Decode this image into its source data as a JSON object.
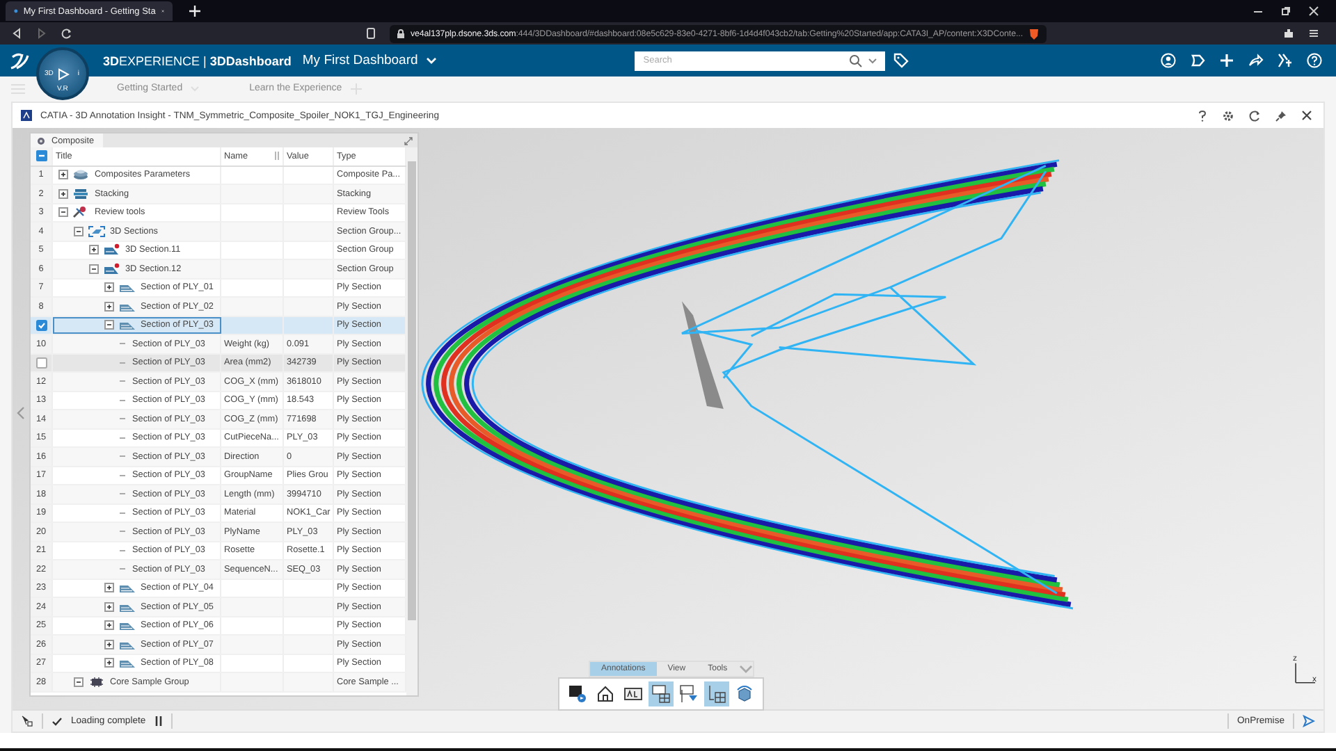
{
  "browser": {
    "tab_title": "My First Dashboard - Getting Sta",
    "url_host": "ve4al137plp.dsone.3ds.com",
    "url_rest": ":444/3DDashboard/#dashboard:08e5c629-83e0-4271-8bf6-1d4d4f043cb2/tab:Getting%20Started/app:CATA3I_AP/content:X3DConte..."
  },
  "header": {
    "brand": "**3D**EXPERIENCE | **3DDashboard**",
    "dashboard": "My First Dashboard",
    "search": {
      "placeholder": "Search"
    },
    "compass_labels": [
      "3D",
      "i",
      "V.R"
    ]
  },
  "dashboard_tabs": [
    "Getting Started",
    "Learn the Experience"
  ],
  "app": {
    "title": "CATIA - 3D Annotation Insight - TNM_Symmetric_Composite_Spoiler_NOK1_TGJ_Engineering"
  },
  "tree": {
    "tab": "Composite",
    "columns": [
      "Title",
      "Name",
      "Value",
      "Type"
    ],
    "rows": [
      {
        "num": "1",
        "kind": "parameters",
        "title": "Composites Parameters",
        "type": "Composite Pa...",
        "expanded": false,
        "selected": false,
        "hovered": false
      },
      {
        "num": "2",
        "kind": "stacking",
        "title": "Stacking",
        "type": "Stacking",
        "expanded": false,
        "selected": false,
        "hovered": false
      },
      {
        "num": "3",
        "kind": "review",
        "title": "Review tools",
        "type": "Review Tools",
        "expanded": true,
        "selected": false,
        "hovered": false,
        "children": [
          {
            "num": "4",
            "kind": "sections",
            "title": "3D Sections",
            "type": "Section Group...",
            "expanded": true,
            "selected": false,
            "hovered": false,
            "children": [
              {
                "num": "5",
                "kind": "group",
                "title": "3D Section.11",
                "type": "Section Group",
                "expanded": false,
                "selected": false,
                "hovered": false
              },
              {
                "num": "6",
                "kind": "group",
                "title": "3D Section.12",
                "type": "Section Group",
                "expanded": true,
                "selected": false,
                "hovered": false,
                "children": [
                  {
                    "num": "7",
                    "kind": "ply",
                    "title": "Section of PLY_01",
                    "type": "Ply Section",
                    "expanded": false,
                    "selected": false,
                    "hovered": false
                  },
                  {
                    "num": "8",
                    "kind": "ply",
                    "title": "Section of PLY_02",
                    "type": "Ply Section",
                    "expanded": false,
                    "selected": false,
                    "hovered": false
                  },
                  {
                    "kind": "ply",
                    "title": "Section of PLY_03",
                    "type": "Ply Section",
                    "expanded": true,
                    "selected": true,
                    "hovered": false,
                    "children": [
                      {
                        "num": "10",
                        "kind": "property",
                        "title": "Section of PLY_03",
                        "name": "Weight (kg)",
                        "value": "0.091",
                        "type": "Ply Section",
                        "selected": false,
                        "hovered": false
                      },
                      {
                        "kind": "property",
                        "title": "Section of PLY_03",
                        "name": "Area (mm2)",
                        "value": "342739",
                        "type": "Ply Section",
                        "selected": false,
                        "hovered": true
                      },
                      {
                        "num": "12",
                        "kind": "property",
                        "title": "Section of PLY_03",
                        "name": "COG_X (mm)",
                        "value": "3618010",
                        "type": "Ply Section",
                        "selected": false,
                        "hovered": false
                      },
                      {
                        "num": "13",
                        "kind": "property",
                        "title": "Section of PLY_03",
                        "name": "COG_Y (mm)",
                        "value": "18.543",
                        "type": "Ply Section",
                        "selected": false,
                        "hovered": false
                      },
                      {
                        "num": "14",
                        "kind": "property",
                        "title": "Section of PLY_03",
                        "name": "COG_Z (mm)",
                        "value": "771698",
                        "type": "Ply Section",
                        "selected": false,
                        "hovered": false
                      },
                      {
                        "num": "15",
                        "kind": "property",
                        "title": "Section of PLY_03",
                        "name": "CutPieceNa...",
                        "value": "PLY_03",
                        "type": "Ply Section",
                        "selected": false,
                        "hovered": false
                      },
                      {
                        "num": "16",
                        "kind": "property",
                        "title": "Section of PLY_03",
                        "name": "Direction",
                        "value": "0",
                        "type": "Ply Section",
                        "selected": false,
                        "hovered": false
                      },
                      {
                        "num": "17",
                        "kind": "property",
                        "title": "Section of PLY_03",
                        "name": "GroupName",
                        "value": "Plies Grou",
                        "type": "Ply Section",
                        "selected": false,
                        "hovered": false
                      },
                      {
                        "num": "18",
                        "kind": "property",
                        "title": "Section of PLY_03",
                        "name": "Length (mm)",
                        "value": "3994710",
                        "type": "Ply Section",
                        "selected": false,
                        "hovered": false
                      },
                      {
                        "num": "19",
                        "kind": "property",
                        "title": "Section of PLY_03",
                        "name": "Material",
                        "value": "NOK1_Car",
                        "type": "Ply Section",
                        "selected": false,
                        "hovered": false
                      },
                      {
                        "num": "20",
                        "kind": "property",
                        "title": "Section of PLY_03",
                        "name": "PlyName",
                        "value": "PLY_03",
                        "type": "Ply Section",
                        "selected": false,
                        "hovered": false
                      },
                      {
                        "num": "21",
                        "kind": "property",
                        "title": "Section of PLY_03",
                        "name": "Rosette",
                        "value": "Rosette.1",
                        "type": "Ply Section",
                        "selected": false,
                        "hovered": false
                      },
                      {
                        "num": "22",
                        "kind": "property",
                        "title": "Section of PLY_03",
                        "name": "SequenceN...",
                        "value": "SEQ_03",
                        "type": "Ply Section",
                        "selected": false,
                        "hovered": false
                      }
                    ]
                  },
                  {
                    "num": "23",
                    "kind": "ply",
                    "title": "Section of PLY_04",
                    "type": "Ply Section",
                    "expanded": false,
                    "selected": false,
                    "hovered": false
                  },
                  {
                    "num": "24",
                    "kind": "ply",
                    "title": "Section of PLY_05",
                    "type": "Ply Section",
                    "expanded": false,
                    "selected": false,
                    "hovered": false
                  },
                  {
                    "num": "25",
                    "kind": "ply",
                    "title": "Section of PLY_06",
                    "type": "Ply Section",
                    "expanded": false,
                    "selected": false,
                    "hovered": false
                  },
                  {
                    "num": "26",
                    "kind": "ply",
                    "title": "Section of PLY_07",
                    "type": "Ply Section",
                    "expanded": false,
                    "selected": false,
                    "hovered": false
                  },
                  {
                    "num": "27",
                    "kind": "ply",
                    "title": "Section of PLY_08",
                    "type": "Ply Section",
                    "expanded": false,
                    "selected": false,
                    "hovered": false
                  }
                ]
              }
            ]
          },
          {
            "num": "28",
            "kind": "core",
            "title": "Core Sample Group",
            "type": "Core Sample ...",
            "expanded": true,
            "selected": false,
            "hovered": false
          }
        ]
      }
    ]
  },
  "toolbar": {
    "tabs": [
      {
        "label": "Annotations",
        "selected": true
      },
      {
        "label": "View",
        "selected": false
      },
      {
        "label": "Tools",
        "selected": false
      }
    ],
    "buttons": [
      {
        "kind": "display",
        "on": false
      },
      {
        "kind": "home",
        "on": false
      },
      {
        "kind": "text",
        "on": false
      },
      {
        "kind": "grid",
        "on": true
      },
      {
        "kind": "filter",
        "on": false
      },
      {
        "kind": "table",
        "on": true
      },
      {
        "kind": "rotate",
        "on": false
      }
    ]
  },
  "axes": [
    "z",
    "x"
  ],
  "status": {
    "message": "Loading complete",
    "mode": "OnPremise"
  }
}
